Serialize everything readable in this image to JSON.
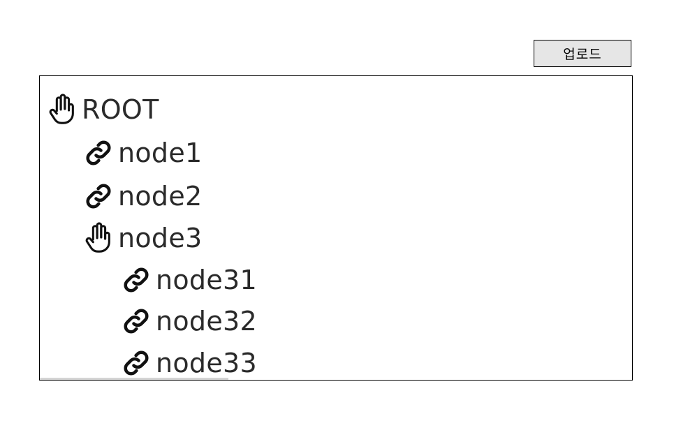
{
  "toolbar": {
    "upload_label": "업로드"
  },
  "tree": {
    "root": {
      "label": "ROOT",
      "icon": "hand-icon"
    },
    "node1": {
      "label": "node1",
      "icon": "link-icon"
    },
    "node2": {
      "label": "node2",
      "icon": "link-icon"
    },
    "node3": {
      "label": "node3",
      "icon": "hand-icon"
    },
    "node31": {
      "label": "node31",
      "icon": "link-icon"
    },
    "node32": {
      "label": "node32",
      "icon": "link-icon"
    },
    "node33": {
      "label": "node33",
      "icon": "link-icon"
    }
  },
  "colors": {
    "button_bg": "#e6e6e6",
    "border": "#000000",
    "text": "#2a2a2a"
  }
}
